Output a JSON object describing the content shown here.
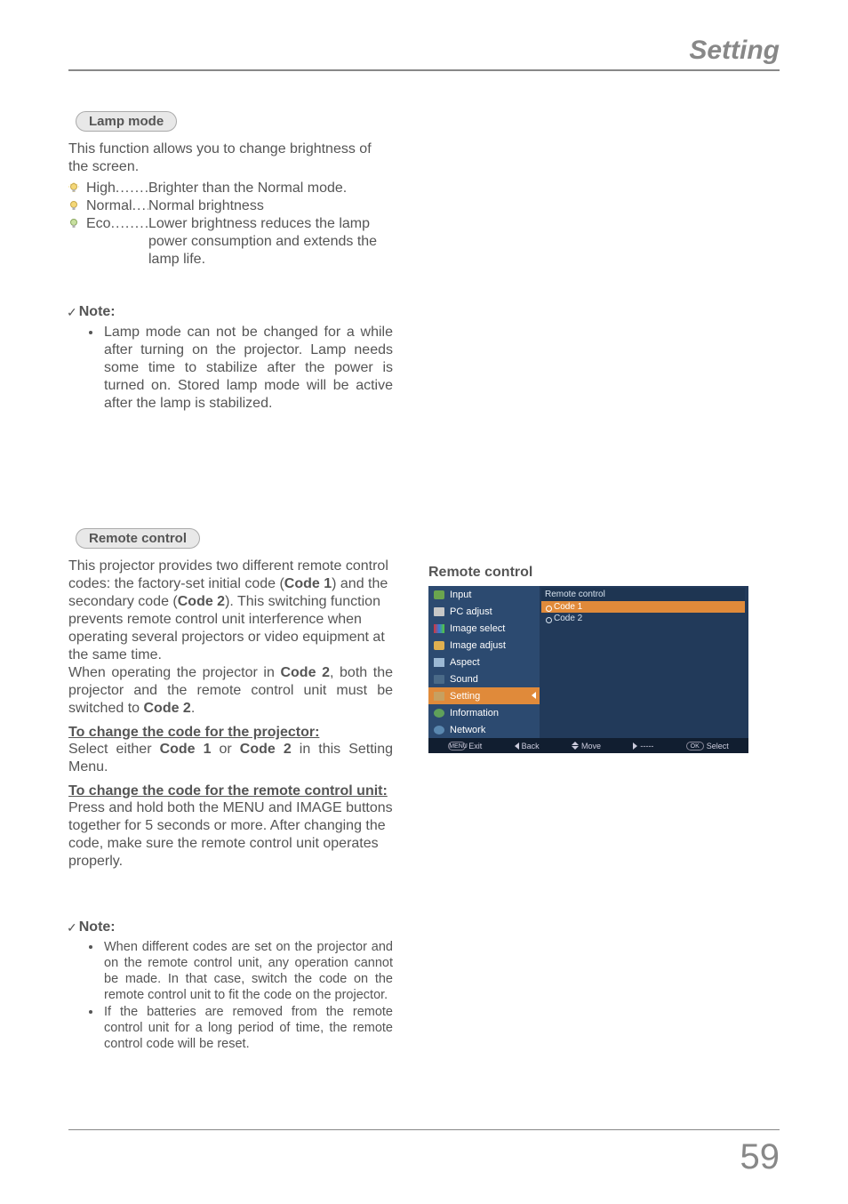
{
  "header": {
    "section": "Setting"
  },
  "page_number": "59",
  "lamp_mode": {
    "pill": "Lamp mode",
    "intro": "This function allows you to change brightness of the screen.",
    "rows": [
      {
        "term": "High",
        "def": "Brighter than the Normal mode."
      },
      {
        "term": "Normal",
        "def": "Normal brightness"
      },
      {
        "term": "Eco",
        "def": "Lower brightness reduces the lamp power consumption and extends the lamp life."
      }
    ],
    "note_label": "Note:",
    "note_items": [
      "Lamp mode can not be changed for a while after turning on the projector. Lamp needs some time to stabilize after the power is turned on. Stored lamp mode will be active after the lamp is stabilized."
    ]
  },
  "remote_control": {
    "pill": "Remote control",
    "p1_a": "This projector provides two different remote control codes: the factory-set initial code (",
    "p1_b1": "Code 1",
    "p1_c": ") and the secondary code (",
    "p1_b2": "Code 2",
    "p1_d": "). This switching function prevents remote control unit interference when operating several projectors or video equipment at the same time.",
    "p2_a": "When operating the projector in ",
    "p2_b": "Code 2",
    "p2_c": ", both the projector and the remote control unit must be switched to ",
    "p2_d": "Code 2",
    "p2_e": ".",
    "h1": "To change the code for the projector:",
    "p3_a": "Select either ",
    "p3_b": "Code 1",
    "p3_c": " or ",
    "p3_d": "Code 2",
    "p3_e": " in this Setting Menu.",
    "h2": "To change the code for the remote control unit:",
    "p4": "Press and hold both the MENU and IMAGE buttons together for 5 seconds or more.  After changing the code, make sure the remote control unit operates properly.",
    "note_label": "Note:",
    "note_items": [
      "When different codes are set on the projector and on the remote control unit, any operation cannot be made. In that case, switch the code on the remote control unit to fit the code on the projector.",
      "If the batteries are removed from the remote control unit for a long period of time, the remote control code will be reset."
    ]
  },
  "osd": {
    "title": "Remote control",
    "panel_title": "Remote control",
    "options": [
      "Code 1",
      "Code 2"
    ],
    "menu": [
      "Input",
      "PC adjust",
      "Image select",
      "Image adjust",
      "Aspect",
      "Sound",
      "Setting",
      "Information",
      "Network"
    ],
    "footer": {
      "exit": "Exit",
      "back": "Back",
      "move": "Move",
      "dash": "-----",
      "select": "Select",
      "menu_key": "MENU",
      "ok_key": "OK"
    }
  }
}
